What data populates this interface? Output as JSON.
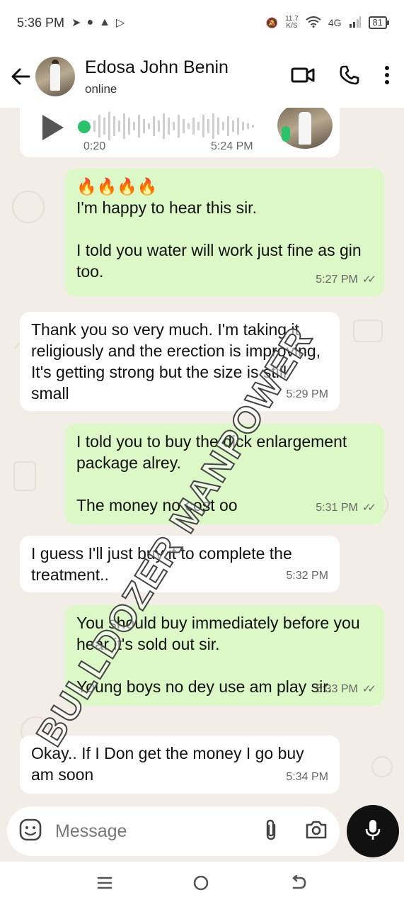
{
  "status_bar": {
    "time": "5:36 PM",
    "net_speed_value": "11.7",
    "net_speed_unit": "K/S",
    "network": "4G",
    "battery": "81"
  },
  "header": {
    "contact_name": "Edosa John Benin",
    "contact_status": "online"
  },
  "voice_message": {
    "duration": "0:20",
    "time": "5:24 PM"
  },
  "messages": [
    {
      "direction": "out",
      "text": "🔥🔥🔥🔥\nI'm happy to hear this sir.\n\nI told you water will work just fine as gin too.",
      "time": "5:27 PM",
      "ticks": "✓✓"
    },
    {
      "direction": "in",
      "text": "Thank you so very much. I'm taking it religiously and the erection is improving, It's getting strong but the size is still small",
      "time": "5:29 PM"
    },
    {
      "direction": "out",
      "text": "I told you to buy the dick enlargement package alrey.\n\nThe money no cost oo",
      "time": "5:31 PM",
      "ticks": "✓✓"
    },
    {
      "direction": "in",
      "text": "I guess I'll just buy it to complete the treatment..",
      "time": "5:32 PM"
    },
    {
      "direction": "out",
      "text": "You should buy immediately before you hear it's sold out sir.\n\nYoung boys no dey use am play sir.",
      "time": "5:33 PM",
      "ticks": "✓✓"
    },
    {
      "direction": "in",
      "text": "Okay.. If I Don get the money I go buy am soon",
      "time": "5:34 PM"
    }
  ],
  "watermark": "BULLDOZER MANPOWER",
  "input": {
    "placeholder": "Message"
  },
  "colors": {
    "outgoing_bubble": "#dcf8c6",
    "incoming_bubble": "#ffffff",
    "chat_background": "#f2ede6",
    "mic_button": "#111111"
  }
}
